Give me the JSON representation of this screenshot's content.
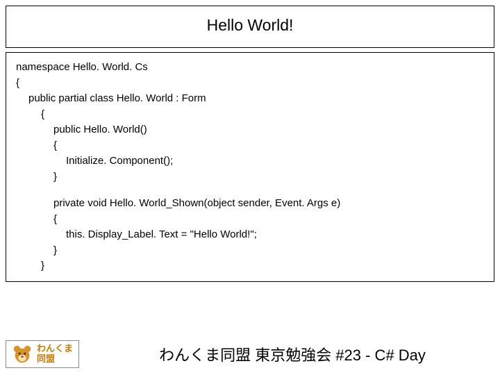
{
  "title": "Hello World!",
  "code": {
    "l1": "namespace Hello. World. Cs",
    "l2": "{",
    "l3": "public partial class Hello. World : Form",
    "l4": "{",
    "l5": "public Hello. World()",
    "l6": "{",
    "l7": "Initialize. Component();",
    "l8": "}",
    "l9": "private void Hello. World_Shown(object sender, Event. Args e)",
    "l10": "{",
    "l11": "this. Display_Label. Text = \"Hello World!\";",
    "l12": "}",
    "l13": "}"
  },
  "logo": {
    "line1": "わんくま",
    "line2": "同盟"
  },
  "footer": "わんくま同盟 東京勉強会 #23 - C# Day"
}
